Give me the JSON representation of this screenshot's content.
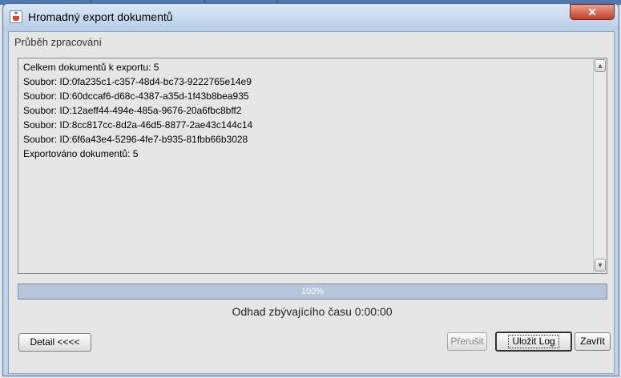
{
  "window": {
    "title": "Hromadný export dokumentů",
    "close_symbol": "✕",
    "accent_color": "#4f77b0"
  },
  "main": {
    "section_title": "Průběh zpracování",
    "log_lines": [
      "Celkem dokumentů k exportu: 5",
      "Soubor: ID:0fa235c1-c357-48d4-bc73-9222765e14e9",
      "Soubor: ID:60dccaf6-d68c-4387-a35d-1f43b8bea935",
      "Soubor: ID:12aeff44-494e-485a-9676-20a6fbc8bff2",
      "Soubor: ID:8cc817cc-8d2a-46d5-8877-2ae43c144c14",
      "Soubor: ID:6f6a43e4-5296-4fe7-b935-81fbb66b3028",
      "Exportováno dokumentů: 5"
    ],
    "progress_label": "100%",
    "progress_value": 100,
    "time_remaining": "Odhad zbývajícího času 0:00:00"
  },
  "buttons": {
    "detail": "Detail <<<<",
    "stop": "Přerušit",
    "save_log": "Uložit Log",
    "close": "Zavřít"
  },
  "icons": {
    "app": "java-app-icon",
    "scroll_up": "scroll-up-arrow-icon",
    "scroll_down": "scroll-down-arrow-icon"
  }
}
